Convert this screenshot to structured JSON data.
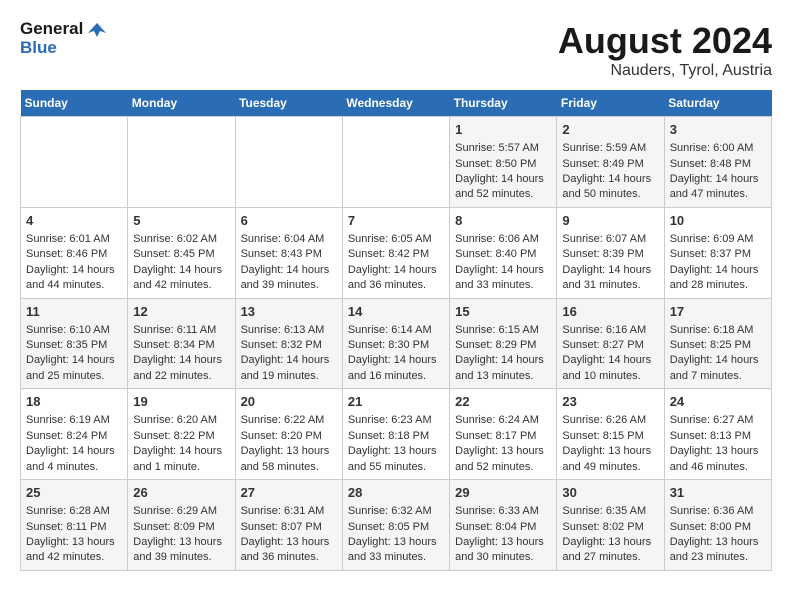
{
  "header": {
    "logo_line1": "General",
    "logo_line2": "Blue",
    "month_year": "August 2024",
    "location": "Nauders, Tyrol, Austria"
  },
  "weekdays": [
    "Sunday",
    "Monday",
    "Tuesday",
    "Wednesday",
    "Thursday",
    "Friday",
    "Saturday"
  ],
  "weeks": [
    [
      {
        "day": "",
        "info": ""
      },
      {
        "day": "",
        "info": ""
      },
      {
        "day": "",
        "info": ""
      },
      {
        "day": "",
        "info": ""
      },
      {
        "day": "1",
        "info": "Sunrise: 5:57 AM\nSunset: 8:50 PM\nDaylight: 14 hours\nand 52 minutes."
      },
      {
        "day": "2",
        "info": "Sunrise: 5:59 AM\nSunset: 8:49 PM\nDaylight: 14 hours\nand 50 minutes."
      },
      {
        "day": "3",
        "info": "Sunrise: 6:00 AM\nSunset: 8:48 PM\nDaylight: 14 hours\nand 47 minutes."
      }
    ],
    [
      {
        "day": "4",
        "info": "Sunrise: 6:01 AM\nSunset: 8:46 PM\nDaylight: 14 hours\nand 44 minutes."
      },
      {
        "day": "5",
        "info": "Sunrise: 6:02 AM\nSunset: 8:45 PM\nDaylight: 14 hours\nand 42 minutes."
      },
      {
        "day": "6",
        "info": "Sunrise: 6:04 AM\nSunset: 8:43 PM\nDaylight: 14 hours\nand 39 minutes."
      },
      {
        "day": "7",
        "info": "Sunrise: 6:05 AM\nSunset: 8:42 PM\nDaylight: 14 hours\nand 36 minutes."
      },
      {
        "day": "8",
        "info": "Sunrise: 6:06 AM\nSunset: 8:40 PM\nDaylight: 14 hours\nand 33 minutes."
      },
      {
        "day": "9",
        "info": "Sunrise: 6:07 AM\nSunset: 8:39 PM\nDaylight: 14 hours\nand 31 minutes."
      },
      {
        "day": "10",
        "info": "Sunrise: 6:09 AM\nSunset: 8:37 PM\nDaylight: 14 hours\nand 28 minutes."
      }
    ],
    [
      {
        "day": "11",
        "info": "Sunrise: 6:10 AM\nSunset: 8:35 PM\nDaylight: 14 hours\nand 25 minutes."
      },
      {
        "day": "12",
        "info": "Sunrise: 6:11 AM\nSunset: 8:34 PM\nDaylight: 14 hours\nand 22 minutes."
      },
      {
        "day": "13",
        "info": "Sunrise: 6:13 AM\nSunset: 8:32 PM\nDaylight: 14 hours\nand 19 minutes."
      },
      {
        "day": "14",
        "info": "Sunrise: 6:14 AM\nSunset: 8:30 PM\nDaylight: 14 hours\nand 16 minutes."
      },
      {
        "day": "15",
        "info": "Sunrise: 6:15 AM\nSunset: 8:29 PM\nDaylight: 14 hours\nand 13 minutes."
      },
      {
        "day": "16",
        "info": "Sunrise: 6:16 AM\nSunset: 8:27 PM\nDaylight: 14 hours\nand 10 minutes."
      },
      {
        "day": "17",
        "info": "Sunrise: 6:18 AM\nSunset: 8:25 PM\nDaylight: 14 hours\nand 7 minutes."
      }
    ],
    [
      {
        "day": "18",
        "info": "Sunrise: 6:19 AM\nSunset: 8:24 PM\nDaylight: 14 hours\nand 4 minutes."
      },
      {
        "day": "19",
        "info": "Sunrise: 6:20 AM\nSunset: 8:22 PM\nDaylight: 14 hours\nand 1 minute."
      },
      {
        "day": "20",
        "info": "Sunrise: 6:22 AM\nSunset: 8:20 PM\nDaylight: 13 hours\nand 58 minutes."
      },
      {
        "day": "21",
        "info": "Sunrise: 6:23 AM\nSunset: 8:18 PM\nDaylight: 13 hours\nand 55 minutes."
      },
      {
        "day": "22",
        "info": "Sunrise: 6:24 AM\nSunset: 8:17 PM\nDaylight: 13 hours\nand 52 minutes."
      },
      {
        "day": "23",
        "info": "Sunrise: 6:26 AM\nSunset: 8:15 PM\nDaylight: 13 hours\nand 49 minutes."
      },
      {
        "day": "24",
        "info": "Sunrise: 6:27 AM\nSunset: 8:13 PM\nDaylight: 13 hours\nand 46 minutes."
      }
    ],
    [
      {
        "day": "25",
        "info": "Sunrise: 6:28 AM\nSunset: 8:11 PM\nDaylight: 13 hours\nand 42 minutes."
      },
      {
        "day": "26",
        "info": "Sunrise: 6:29 AM\nSunset: 8:09 PM\nDaylight: 13 hours\nand 39 minutes."
      },
      {
        "day": "27",
        "info": "Sunrise: 6:31 AM\nSunset: 8:07 PM\nDaylight: 13 hours\nand 36 minutes."
      },
      {
        "day": "28",
        "info": "Sunrise: 6:32 AM\nSunset: 8:05 PM\nDaylight: 13 hours\nand 33 minutes."
      },
      {
        "day": "29",
        "info": "Sunrise: 6:33 AM\nSunset: 8:04 PM\nDaylight: 13 hours\nand 30 minutes."
      },
      {
        "day": "30",
        "info": "Sunrise: 6:35 AM\nSunset: 8:02 PM\nDaylight: 13 hours\nand 27 minutes."
      },
      {
        "day": "31",
        "info": "Sunrise: 6:36 AM\nSunset: 8:00 PM\nDaylight: 13 hours\nand 23 minutes."
      }
    ]
  ]
}
